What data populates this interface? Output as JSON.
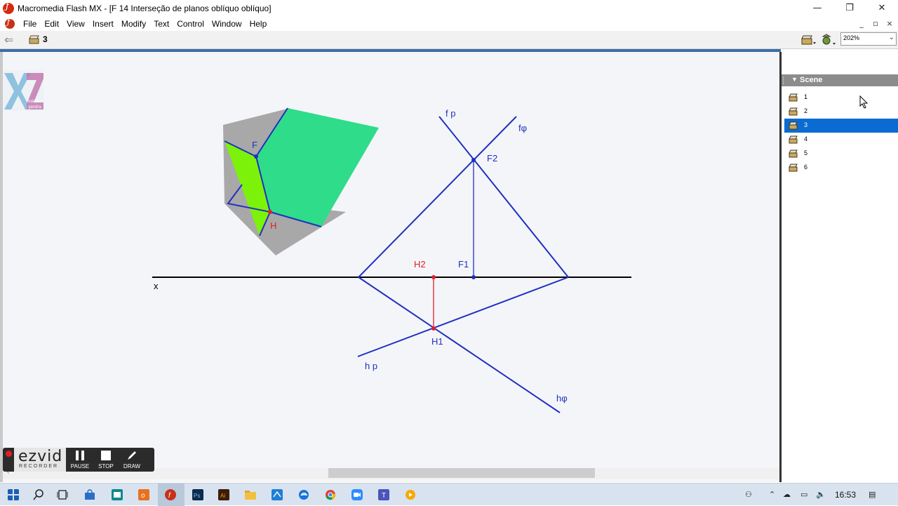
{
  "window": {
    "title": "Macromedia Flash MX - [F 14 Interseção de planos oblíquo oblíquo]",
    "minimize": "—",
    "restore": "❐",
    "close": "✕"
  },
  "menu": [
    "File",
    "Edit",
    "View",
    "Insert",
    "Modify",
    "Text",
    "Control",
    "Window",
    "Help"
  ],
  "editbar": {
    "current_scene": "3",
    "zoom": "202%"
  },
  "panel": {
    "title": "Scene",
    "scenes": [
      "1",
      "2",
      "3",
      "4",
      "5",
      "6"
    ],
    "selected_index": 2
  },
  "watermark": {
    "letters": "XYZ",
    "text_line1": "mário",
    "text_line2": "gandra"
  },
  "drawing": {
    "labels": {
      "F_solid": "F",
      "H_solid": "H",
      "fp": "f p",
      "fphi": "fφ",
      "F2": "F2",
      "F1": "F1",
      "H2": "H2",
      "H1": "H1",
      "x": "x",
      "hp": "h p",
      "hphi": "hφ"
    },
    "colors": {
      "trace": "#2030c0",
      "point_red": "#e0202a",
      "plane_green": "#2fdc8a",
      "plane_lime": "#7cf20a",
      "shadow_gray": "#a8a8a8",
      "axis": "#000000"
    }
  },
  "ezvid": {
    "logo": "ezvid",
    "sub": "RECORDER",
    "buttons": [
      "PAUSE",
      "STOP",
      "DRAW"
    ]
  },
  "taskbar": {
    "time": "16:53"
  }
}
